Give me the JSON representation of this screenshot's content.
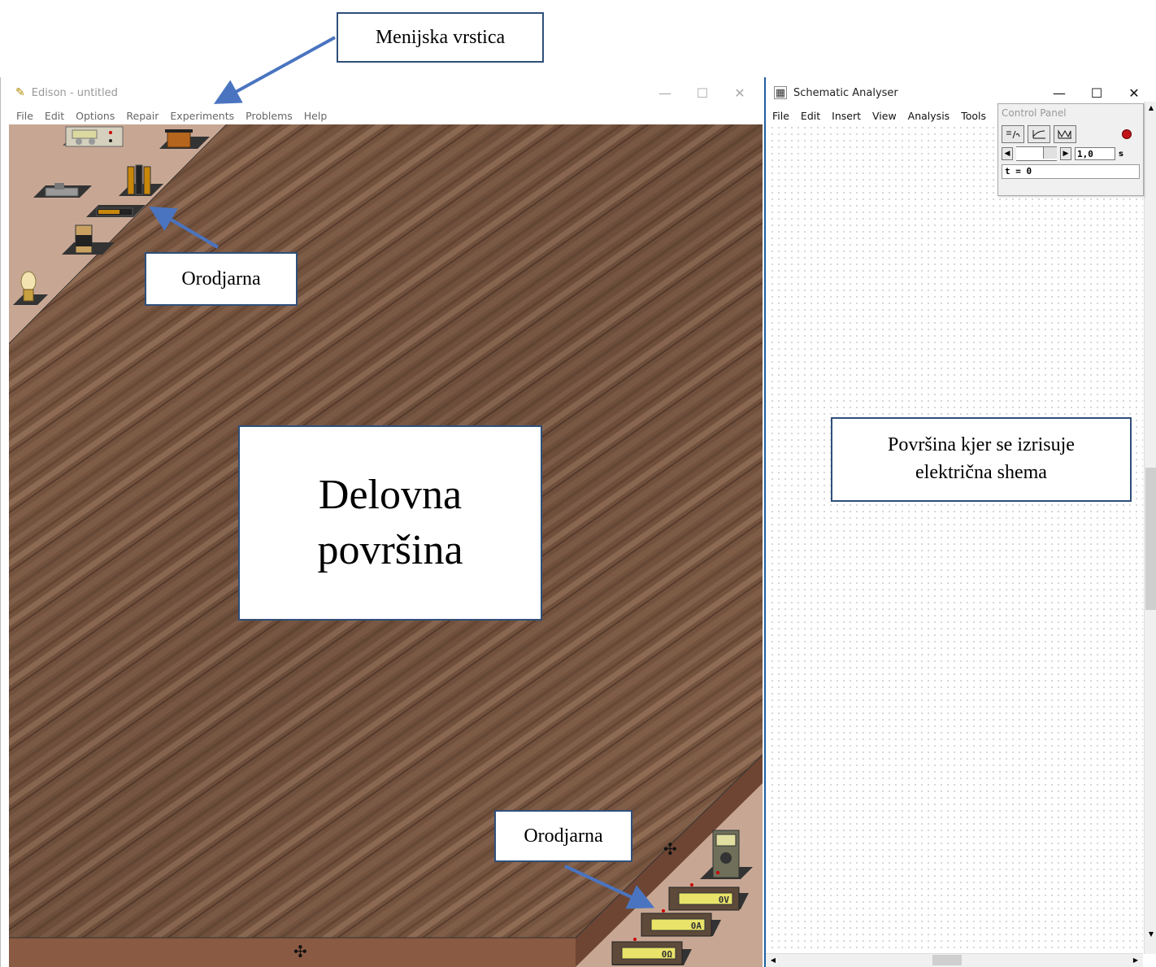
{
  "edison": {
    "title": "Edison - untitled",
    "menu": [
      "File",
      "Edit",
      "Options",
      "Repair",
      "Experiments",
      "Problems",
      "Help"
    ],
    "window_buttons": {
      "minimize": "—",
      "maximize": "☐",
      "close": "✕"
    }
  },
  "schematic": {
    "title": "Schematic Analyser",
    "menu": [
      "File",
      "Edit",
      "Insert",
      "View",
      "Analysis",
      "Tools"
    ],
    "window_buttons": {
      "minimize": "—",
      "maximize": "☐",
      "close": "✕"
    },
    "control_panel": {
      "title": "Control Panel",
      "speed_value": "1,0",
      "speed_unit": "s",
      "time_readout": "t = 0"
    }
  },
  "meters": {
    "voltmeter": "0V",
    "ammeter": "0A",
    "ohmmeter": "0Ω"
  },
  "callouts": {
    "menu_bar": "Menijska vrstica",
    "toolbox_top": "Orodjarna",
    "workspace": "Delovna površina",
    "schematic_area": "Površina kjer se izrisuje električna shema",
    "toolbox_bottom": "Orodjarna"
  },
  "colors": {
    "wood": "#7a5640",
    "shelf": "#c7a794",
    "callout_border": "#2f4f7a",
    "arrow": "#4a74c0"
  }
}
